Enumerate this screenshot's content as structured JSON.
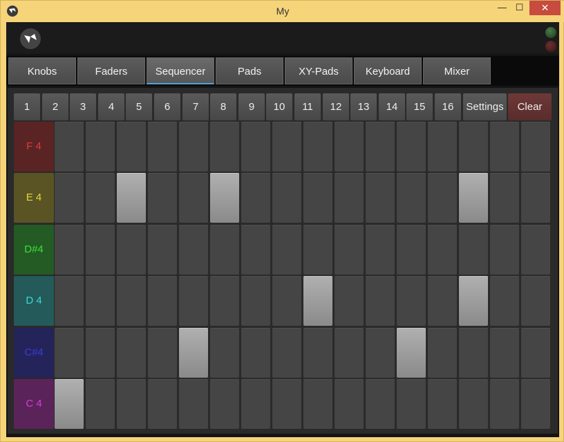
{
  "window": {
    "title": "My",
    "min_glyph": "—",
    "max_glyph": "☐",
    "close_glyph": "✕"
  },
  "tabs": [
    {
      "label": "Knobs",
      "active": false
    },
    {
      "label": "Faders",
      "active": false
    },
    {
      "label": "Sequencer",
      "active": true
    },
    {
      "label": "Pads",
      "active": false
    },
    {
      "label": "XY-Pads",
      "active": false
    },
    {
      "label": "Keyboard",
      "active": false
    },
    {
      "label": "Mixer",
      "active": false
    }
  ],
  "steps": [
    "1",
    "2",
    "3",
    "4",
    "5",
    "6",
    "7",
    "8",
    "9",
    "10",
    "11",
    "12",
    "13",
    "14",
    "15",
    "16"
  ],
  "settings_label": "Settings",
  "clear_label": "Clear",
  "notes": [
    {
      "label": "F 4",
      "bg": "#5a2424",
      "fg": "#e03a3a",
      "active_steps": []
    },
    {
      "label": "E 4",
      "bg": "#5a5424",
      "fg": "#e0d83a",
      "active_steps": [
        3,
        6,
        14
      ]
    },
    {
      "label": "D#4",
      "bg": "#245a24",
      "fg": "#3ae03a",
      "active_steps": []
    },
    {
      "label": "D 4",
      "bg": "#245a5a",
      "fg": "#3ad8d8",
      "active_steps": [
        9,
        14
      ]
    },
    {
      "label": "C#4",
      "bg": "#24245a",
      "fg": "#3a3ae0",
      "active_steps": [
        5,
        12
      ]
    },
    {
      "label": "C 4",
      "bg": "#5a245a",
      "fg": "#d83ad8",
      "active_steps": [
        1
      ]
    }
  ],
  "leds": {
    "top": "green-icon",
    "bottom": "red-icon"
  }
}
